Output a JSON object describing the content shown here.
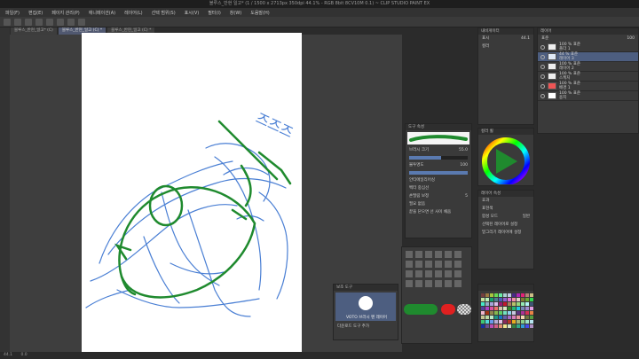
{
  "app": {
    "title": "블루스_반현 일고* (1 / 1500 x 2713px 350dpi 44.1% - RGB 8bit 8CV10M 0.1) ~ CLIP STUDIO PAINT EX"
  },
  "menu": [
    "파일(F)",
    "편집(E)",
    "페이지 관리(P)",
    "애니메이션(A)",
    "레이어(L)",
    "선택 범위(S)",
    "표시(V)",
    "필터(I)",
    "창(W)",
    "도움말(H)"
  ],
  "tabs": [
    {
      "label": "블루스_반현_일고* (C)",
      "active": false
    },
    {
      "label": "블루스_반현_일고 (C) *",
      "active": true
    },
    {
      "label": "블루스_반현_일고 (C) *",
      "active": false
    }
  ],
  "canvas": {
    "sketch_text": "즈즈즈"
  },
  "brush_panel": {
    "header": "도구 속성",
    "brush_name": "VOTO 브러시 펜 레이어",
    "size_label": "브러시 크기",
    "size_value": "55.0",
    "opacity_label": "불투명도",
    "opacity_value": "100",
    "aa_label": "안티에일리어싱",
    "stabilize_label": "손떨림 보정",
    "stabilize_value": "5",
    "vector_label": "벡터 중심선",
    "fill_label": "필요 없음",
    "checkbox_label": "끝을 닫으면 선 사이 채움"
  },
  "sub_tool_panel": {
    "header": "보조 도구",
    "brush_label": "VOTO 브러시 펜 레이어",
    "add_label": "다운로드 도구 추가"
  },
  "color_panel": {
    "header": "컬러 휠",
    "main_color": "#1f8a2e",
    "sub_color": "#e02020"
  },
  "navigator": {
    "header": "내비게이터",
    "zoom_label": "표시",
    "zoom_value": "44.1"
  },
  "layer_props": {
    "header": "레이어 속성",
    "effect_label": "효과",
    "expression_label": "표현색",
    "expression_value": "컬러",
    "blend_label": "합성 모드",
    "blend_value": "일반",
    "check1": "선택된 레이어로 설정",
    "check2": "밑그리기 레이어에 설정"
  },
  "layers_panel": {
    "header": "레이어",
    "blend_value": "표준",
    "opacity_value": "100",
    "layers": [
      {
        "name": "100 % 표준",
        "sub": "폴더 1",
        "sel": false,
        "color": "#eeeeee"
      },
      {
        "name": "44 % 표준",
        "sub": "레이어 3",
        "sel": true,
        "color": "#dfe9f7"
      },
      {
        "name": "100 % 표준",
        "sub": "레이어 2",
        "sel": false,
        "color": "#eeeeee"
      },
      {
        "name": "100 % 표준",
        "sub": "스케치",
        "sel": false,
        "color": "#eeeeee"
      },
      {
        "name": "100 % 표준",
        "sub": "배경 1",
        "sel": false,
        "color": "#ee5555"
      },
      {
        "name": "100 % 표준",
        "sub": "용지",
        "sel": false,
        "color": "#ffffff"
      }
    ]
  },
  "status": {
    "zoom": "44.1",
    "coords": "0.0"
  }
}
